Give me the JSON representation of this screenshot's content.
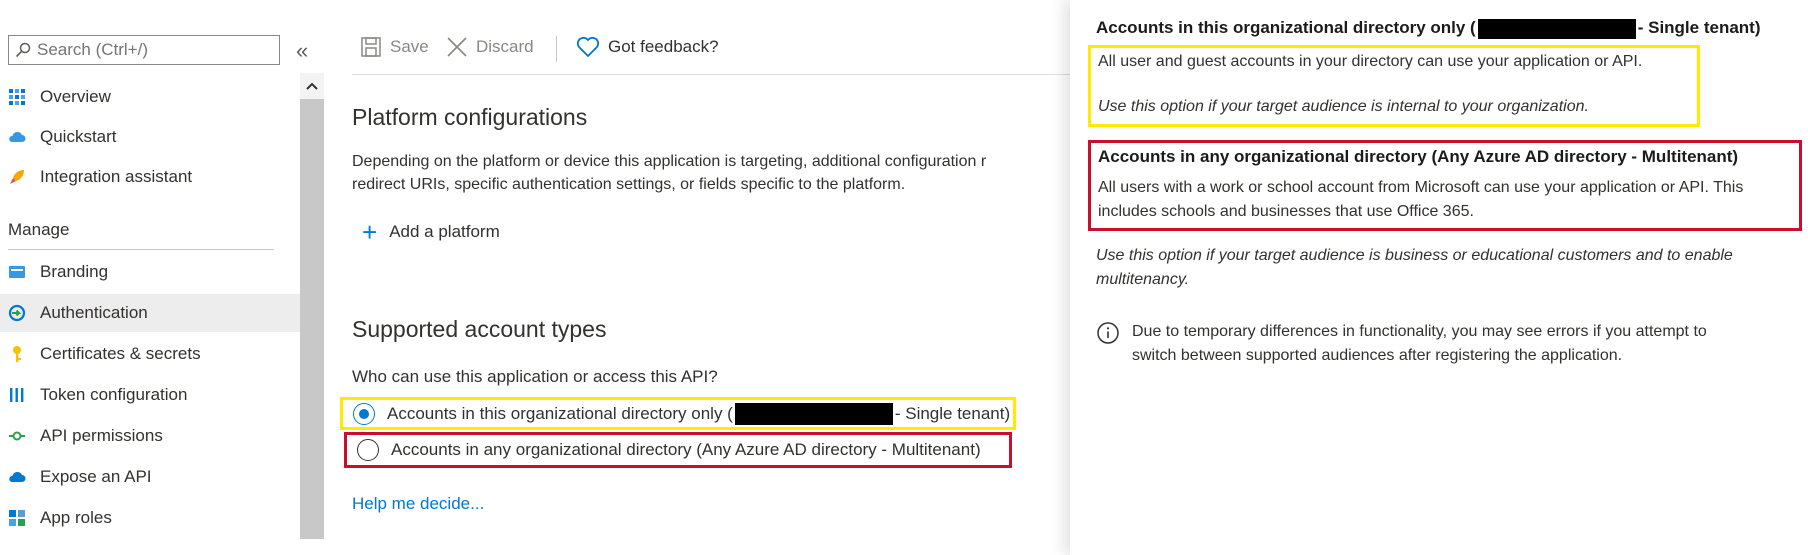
{
  "sidebar": {
    "search_placeholder": "Search (Ctrl+/)",
    "collapse_glyph": "«",
    "items_top": [
      {
        "label": "Overview",
        "icon": "grid-icon"
      },
      {
        "label": "Quickstart",
        "icon": "cloud-icon"
      },
      {
        "label": "Integration assistant",
        "icon": "rocket-icon"
      }
    ],
    "section_label": "Manage",
    "items_manage": [
      {
        "label": "Branding",
        "icon": "branding-icon"
      },
      {
        "label": "Authentication",
        "icon": "auth-icon"
      },
      {
        "label": "Certificates & secrets",
        "icon": "key-icon"
      },
      {
        "label": "Token configuration",
        "icon": "bars-icon"
      },
      {
        "label": "API permissions",
        "icon": "api-icon"
      },
      {
        "label": "Expose an API",
        "icon": "cloud-icon"
      },
      {
        "label": "App roles",
        "icon": "grid-icon"
      }
    ],
    "active_item": "Authentication"
  },
  "toolbar": {
    "save_label": "Save",
    "discard_label": "Discard",
    "feedback_label": "Got feedback?"
  },
  "main": {
    "platform_title": "Platform configurations",
    "platform_desc_line1": "Depending on the platform or device this application is targeting, additional configuration r",
    "platform_desc_line2": "redirect URIs, specific authentication settings, or fields specific to the platform.",
    "add_platform_label": "Add a platform",
    "account_types_title": "Supported account types",
    "account_question": "Who can use this application or access this API?",
    "option_single_prefix": "Accounts in this organizational directory only (",
    "option_single_suffix": "- Single tenant)",
    "option_multi": "Accounts in any organizational directory (Any Azure AD directory - Multitenant)",
    "selected_option": "single",
    "help_link": "Help me decide..."
  },
  "info_panel": {
    "single_title_prefix": "Accounts in this organizational directory only (",
    "single_title_suffix": "- Single tenant)",
    "single_desc": "All user and guest accounts in your directory can use your application or API.",
    "single_usage": "Use this option if your target audience is internal to your organization.",
    "multi_title": "Accounts in any organizational directory (Any Azure AD directory - Multitenant)",
    "multi_desc_line1": "All users with a work or school account from Microsoft can use your application or API. This",
    "multi_desc_line2": "includes schools and businesses that use Office 365.",
    "multi_usage_line1": "Use this option if your target audience is business or educational customers and to enable",
    "multi_usage_line2": "multitenancy.",
    "note_line1": "Due to temporary differences in functionality, you may see errors if you attempt to",
    "note_line2": "switch between supported audiences after registering the application."
  },
  "colors": {
    "accent": "#0078d4",
    "highlight_yellow": "#ffea00",
    "highlight_red": "#c8102e"
  }
}
